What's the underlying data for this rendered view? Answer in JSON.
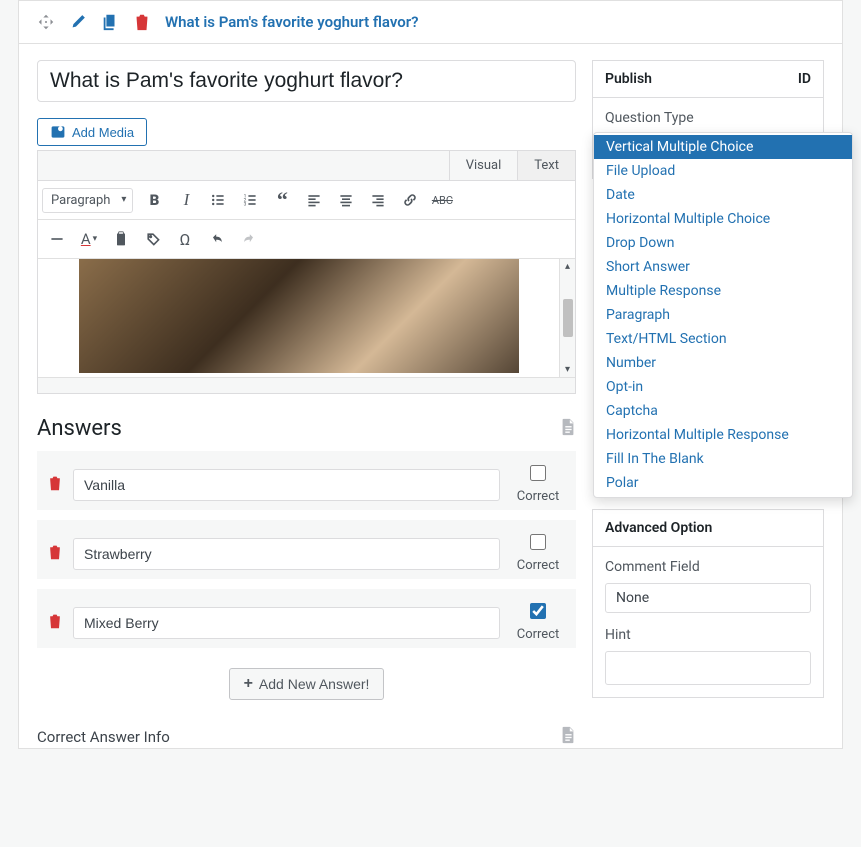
{
  "header": {
    "title_link": "What is Pam's favorite yoghurt flavor?"
  },
  "main": {
    "title_value": "What is Pam's favorite yoghurt flavor?",
    "add_media_label": "Add Media",
    "editor_tabs": {
      "visual": "Visual",
      "text": "Text"
    },
    "format_select": "Paragraph",
    "answers_heading": "Answers",
    "answers": [
      {
        "value": "Vanilla",
        "correct": false
      },
      {
        "value": "Strawberry",
        "correct": false
      },
      {
        "value": "Mixed Berry",
        "correct": true
      }
    ],
    "correct_label": "Correct",
    "add_new_answer": "Add New Answer!",
    "correct_answer_info": "Correct Answer Info"
  },
  "side": {
    "publish": {
      "title": "Publish",
      "id_label": "ID"
    },
    "question_type": {
      "label": "Question Type",
      "selected": "Vertical Multiple Choice",
      "options": [
        "Vertical Multiple Choice",
        "File Upload",
        "Date",
        "Horizontal Multiple Choice",
        "Drop Down",
        "Short Answer",
        "Multiple Response",
        "Paragraph",
        "Text/HTML Section",
        "Number",
        "Opt-in",
        "Captcha",
        "Horizontal Multiple Response",
        "Fill In The Blank",
        "Polar"
      ]
    },
    "advanced": {
      "title": "Advanced Option",
      "comment_field_label": "Comment Field",
      "comment_field_value": "None",
      "hint_label": "Hint"
    }
  }
}
